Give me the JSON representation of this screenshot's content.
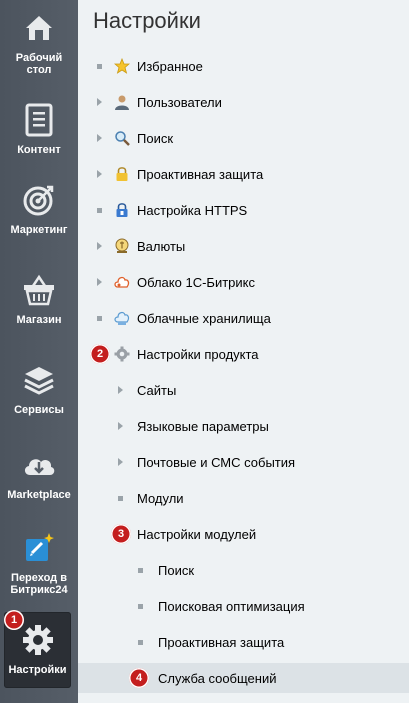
{
  "sidebar": {
    "items": [
      {
        "label": "Рабочий стол",
        "icon": "home-icon"
      },
      {
        "label": "Контент",
        "icon": "document-icon"
      },
      {
        "label": "Маркетинг",
        "icon": "target-icon"
      },
      {
        "label": "Магазин",
        "icon": "basket-icon"
      },
      {
        "label": "Сервисы",
        "icon": "layers-icon"
      },
      {
        "label": "Marketplace",
        "icon": "cloud-download-icon"
      },
      {
        "label": "Переход в Битрикс24",
        "icon": "bitrix24-icon"
      },
      {
        "label": "Настройки",
        "icon": "gear-icon",
        "active": true
      }
    ]
  },
  "main": {
    "title": "Настройки",
    "items": [
      {
        "label": "Избранное",
        "marker": "bullet",
        "icon": "star-icon"
      },
      {
        "label": "Пользователи",
        "marker": "arrow",
        "icon": "user-icon"
      },
      {
        "label": "Поиск",
        "marker": "arrow",
        "icon": "magnifier-icon"
      },
      {
        "label": "Проактивная защита",
        "marker": "arrow",
        "icon": "lock-icon"
      },
      {
        "label": "Настройка HTTPS",
        "marker": "bullet",
        "icon": "https-lock-icon"
      },
      {
        "label": "Валюты",
        "marker": "arrow",
        "icon": "coin-icon"
      },
      {
        "label": "Облако 1С-Битрикс",
        "marker": "arrow",
        "icon": "cloud-icon"
      },
      {
        "label": "Облачные хранилища",
        "marker": "bullet",
        "icon": "cloud-storage-icon"
      },
      {
        "label": "Настройки продукта",
        "marker": "none",
        "icon": "gear-icon"
      },
      {
        "label": "Сайты",
        "marker": "arrow"
      },
      {
        "label": "Языковые параметры",
        "marker": "arrow"
      },
      {
        "label": "Почтовые и СМС события",
        "marker": "arrow"
      },
      {
        "label": "Модули",
        "marker": "bullet"
      },
      {
        "label": "Настройки модулей",
        "marker": "none"
      },
      {
        "label": "Поиск",
        "marker": "bullet"
      },
      {
        "label": "Поисковая оптимизация",
        "marker": "bullet"
      },
      {
        "label": "Проактивная защита",
        "marker": "bullet"
      },
      {
        "label": "Служба сообщений",
        "marker": "none",
        "selected": true
      }
    ]
  },
  "badges": [
    "1",
    "2",
    "3",
    "4"
  ],
  "colors": {
    "badge": "#c41e1e",
    "sidebar": "#525a64",
    "active_item": "#2b2f35",
    "selected_row": "#dce2e6"
  }
}
